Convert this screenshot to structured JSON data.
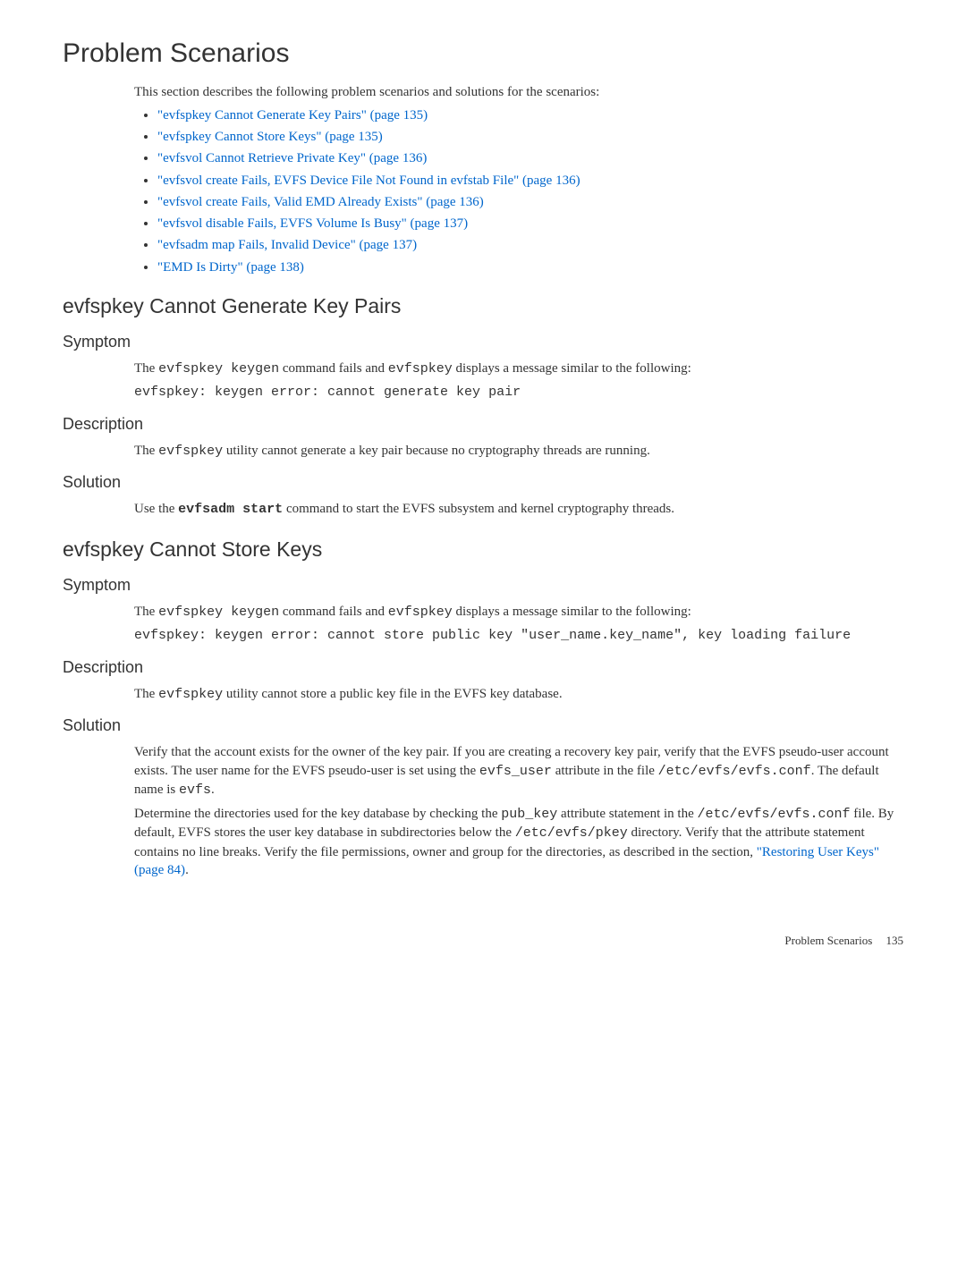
{
  "title": "Problem Scenarios",
  "intro": "This section describes the following problem scenarios and solutions for the scenarios:",
  "toc": [
    "\"evfspkey Cannot Generate Key Pairs\" (page 135)",
    "\"evfspkey Cannot Store Keys\" (page 135)",
    "\"evfsvol Cannot Retrieve Private Key\" (page 136)",
    "\"evfsvol create Fails, EVFS Device File Not Found in evfstab File\" (page 136)",
    "\"evfsvol create Fails, Valid EMD Already Exists\" (page 136)",
    "\"evfsvol disable Fails, EVFS Volume Is Busy\" (page 137)",
    "\"evfsadm map Fails, Invalid Device\" (page 137)",
    "\"EMD Is Dirty\" (page 138)"
  ],
  "section1": {
    "heading": "evfspkey Cannot Generate Key Pairs",
    "symptom_label": "Symptom",
    "symptom_pre": "The ",
    "symptom_code1": "evfspkey keygen",
    "symptom_mid": " command fails and ",
    "symptom_code2": "evfspkey",
    "symptom_post": " displays a message similar to the following:",
    "symptom_output": "evfspkey: keygen error: cannot generate key pair",
    "description_label": "Description",
    "description_pre": "The ",
    "description_code": "evfspkey",
    "description_post": " utility cannot generate a key pair because no cryptography threads are running.",
    "solution_label": "Solution",
    "solution_pre": "Use the ",
    "solution_code": "evfsadm start",
    "solution_post": " command to start the EVFS subsystem and kernel cryptography threads."
  },
  "section2": {
    "heading": "evfspkey Cannot Store Keys",
    "symptom_label": "Symptom",
    "symptom_pre": "The ",
    "symptom_code1": "evfspkey keygen",
    "symptom_mid": " command fails and ",
    "symptom_code2": "evfspkey",
    "symptom_post": " displays a message similar to the following:",
    "symptom_output": "evfspkey: keygen error: cannot store public key \"user_name.key_name\", key loading failure",
    "description_label": "Description",
    "description_pre": "The ",
    "description_code": "evfspkey",
    "description_post": " utility cannot store a public key file in the EVFS key database.",
    "solution_label": "Solution",
    "solution_p1_a": "Verify that the account exists for the owner of the key pair. If you are creating a recovery key pair, verify that the EVFS pseudo-user account exists. The user name for the EVFS pseudo-user is set using the ",
    "solution_p1_code1": "evfs_user",
    "solution_p1_b": " attribute in the file ",
    "solution_p1_code2": "/etc/evfs/evfs.conf",
    "solution_p1_c": ". The default name is ",
    "solution_p1_code3": "evfs",
    "solution_p1_d": ".",
    "solution_p2_a": "Determine the directories used for the key database by checking the ",
    "solution_p2_code1": "pub_key",
    "solution_p2_b": " attribute statement in the ",
    "solution_p2_code2": "/etc/evfs/evfs.conf",
    "solution_p2_c": " file. By default, EVFS stores the user key database in subdirectories below the ",
    "solution_p2_code3": "/etc/evfs/pkey",
    "solution_p2_d": " directory. Verify that the attribute statement contains no line breaks. Verify the file permissions, owner and group for the directories, as described in the section, ",
    "solution_p2_link": "\"Restoring User Keys\" (page 84)",
    "solution_p2_e": "."
  },
  "footer": {
    "label": "Problem Scenarios",
    "page": "135"
  }
}
